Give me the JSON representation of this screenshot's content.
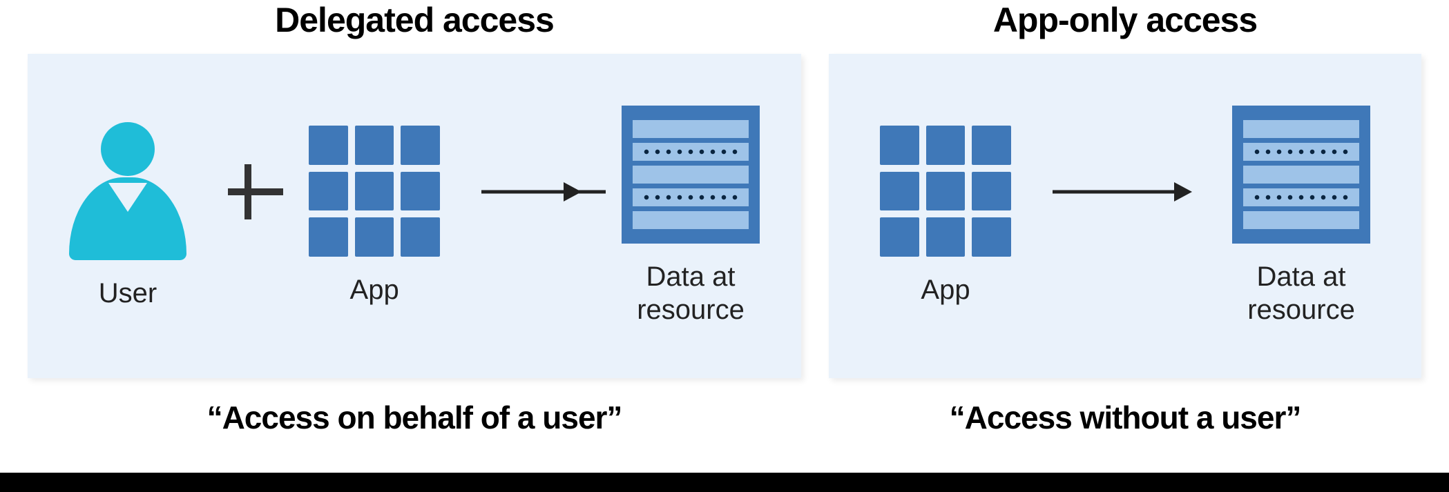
{
  "left": {
    "title": "Delegated access",
    "subtitle": "“Access on behalf of a user”",
    "user_label": "User",
    "app_label": "App",
    "data_label": "Data at\nresource"
  },
  "right": {
    "title": "App-only access",
    "subtitle": "“Access without a user”",
    "app_label": "App",
    "data_label": "Data at\nresource"
  }
}
